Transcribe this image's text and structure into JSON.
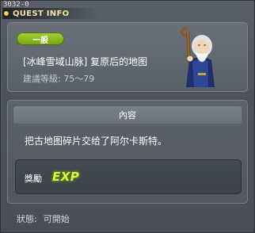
{
  "window": {
    "quest_id": "3032-0",
    "title": "QUEST INFO"
  },
  "header": {
    "category_badge": "一般",
    "quest_name": "[冰峰雪域山脉] 复原后的地图",
    "level_text": "建議等級: 75～79"
  },
  "npc": {
    "icon": "old-wizard-npc-icon"
  },
  "content": {
    "section_title": "內容",
    "description": "把古地图碎片交给了阿尔卡斯特。"
  },
  "reward": {
    "label": "獎勵",
    "exp_label": "EXP"
  },
  "status": {
    "label": "狀態:",
    "value": "可開始"
  },
  "colors": {
    "badge_green": "#8cbf24",
    "title_gold": "#f4e3a0",
    "exp_yellow": "#e8f14a"
  }
}
